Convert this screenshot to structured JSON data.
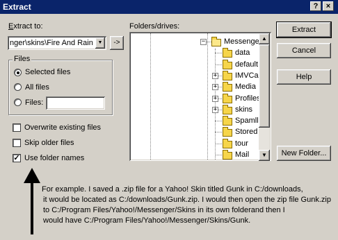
{
  "window": {
    "title": "Extract",
    "help_glyph": "?",
    "close_glyph": "×"
  },
  "extract_to": {
    "label": "Extract to:",
    "value": "nger\\skins\\Fire And Rain",
    "dropdown_glyph": "▼",
    "browse_glyph": "->"
  },
  "files_group": {
    "label": "Files",
    "options": [
      {
        "label": "Selected files",
        "selected": true
      },
      {
        "label": "All files",
        "selected": false
      },
      {
        "label": "Files:",
        "selected": false
      }
    ],
    "files_input_value": ""
  },
  "checkboxes": [
    {
      "label": "Overwrite existing files",
      "checked": false
    },
    {
      "label": "Skip older files",
      "checked": false
    },
    {
      "label": "Use folder names",
      "checked": true,
      "check_glyph": "✓"
    }
  ],
  "folders": {
    "label": "Folders/drives:",
    "items": [
      {
        "label": "Messenger",
        "expander": "−",
        "open": true
      },
      {
        "label": "data",
        "expander": ""
      },
      {
        "label": "default",
        "expander": ""
      },
      {
        "label": "IMVCa",
        "expander": "+"
      },
      {
        "label": "Media",
        "expander": "+"
      },
      {
        "label": "Profiles",
        "expander": "+"
      },
      {
        "label": "skins",
        "expander": "+"
      },
      {
        "label": "Spamll",
        "expander": ""
      },
      {
        "label": "Stored",
        "expander": ""
      },
      {
        "label": "tour",
        "expander": ""
      },
      {
        "label": "Mail",
        "expander": ""
      }
    ],
    "scroll_up_glyph": "▲",
    "scroll_down_glyph": "▼"
  },
  "buttons": {
    "extract": "Extract",
    "cancel": "Cancel",
    "help": "Help",
    "new_folder": "New Folder..."
  },
  "annotation": {
    "lines": [
      "For example. I saved a .zip file for a Yahoo! Skin titled Gunk in C:/downloads,",
      "it would be located as C:/downloads/Gunk.zip. I would then open the zip file Gunk.zip",
      " to C:/Program Files/Yahoo!/Messenger/Skins in its own folderand then I",
      "would have C:/Program Files/Yahoo!/Messenger/Skins/Gunk."
    ]
  }
}
